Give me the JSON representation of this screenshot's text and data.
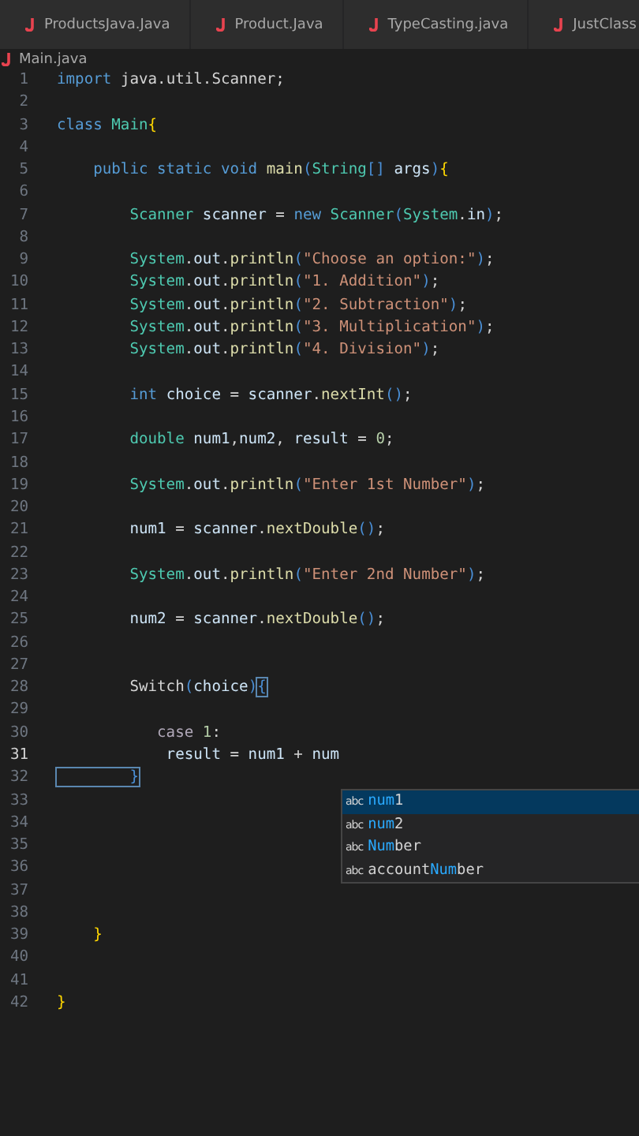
{
  "tabs": [
    {
      "label": "ProductsJava.Java",
      "selected": false
    },
    {
      "label": "Product.Java",
      "selected": false
    },
    {
      "label": "TypeCasting.java",
      "selected": false
    },
    {
      "label": "JustClass",
      "selected": false
    }
  ],
  "breadcrumb": "Main.java",
  "lines": [
    {
      "number": "1",
      "current": false,
      "tokens": [
        {
          "text": "import ",
          "kind": "kw"
        },
        {
          "text": "java.util.Scanner;",
          "kind": "plain"
        }
      ]
    },
    {
      "number": "2",
      "current": false
    },
    {
      "number": "3",
      "current": false,
      "tokens": [
        {
          "text": "class ",
          "kind": "kw"
        },
        {
          "text": "Main",
          "kind": "type"
        },
        {
          "text": "{",
          "kind": "brace"
        }
      ]
    },
    {
      "number": "4",
      "current": false
    },
    {
      "number": "5",
      "current": false,
      "tokens": [
        {
          "text": "    public static void ",
          "kind": "kw"
        },
        {
          "text": "main",
          "kind": "fn"
        },
        {
          "text": "(",
          "kind": "paren"
        },
        {
          "text": "String",
          "kind": "type"
        },
        {
          "text": "[] ",
          "kind": "paren"
        },
        {
          "text": "args",
          "kind": "var"
        },
        {
          "text": ")",
          "kind": "paren"
        },
        {
          "text": "{",
          "kind": "brace"
        }
      ]
    },
    {
      "number": "6",
      "current": false
    },
    {
      "number": "7",
      "current": false,
      "tokens": [
        {
          "text": "        Scanner ",
          "kind": "type"
        },
        {
          "text": "scanner",
          "kind": "var"
        },
        {
          "text": " = ",
          "kind": "plain"
        },
        {
          "text": "new ",
          "kind": "kw"
        },
        {
          "text": "Scanner",
          "kind": "type"
        },
        {
          "text": "(",
          "kind": "paren"
        },
        {
          "text": "System",
          "kind": "type"
        },
        {
          "text": ".",
          "kind": "plain"
        },
        {
          "text": "in",
          "kind": "var"
        },
        {
          "text": ")",
          "kind": "paren"
        },
        {
          "text": ";",
          "kind": "plain"
        }
      ]
    },
    {
      "number": "8",
      "current": false
    },
    {
      "number": "9",
      "current": false,
      "tokens": [
        {
          "text": "        System",
          "kind": "type"
        },
        {
          "text": ".",
          "kind": "plain"
        },
        {
          "text": "out",
          "kind": "var"
        },
        {
          "text": ".",
          "kind": "plain"
        },
        {
          "text": "println",
          "kind": "fn"
        },
        {
          "text": "(",
          "kind": "paren"
        },
        {
          "text": "\"Choose an option:\"",
          "kind": "str"
        },
        {
          "text": ")",
          "kind": "paren"
        },
        {
          "text": ";",
          "kind": "plain"
        }
      ]
    },
    {
      "number": "10",
      "current": false,
      "tokens": [
        {
          "text": "        System",
          "kind": "type"
        },
        {
          "text": ".",
          "kind": "plain"
        },
        {
          "text": "out",
          "kind": "var"
        },
        {
          "text": ".",
          "kind": "plain"
        },
        {
          "text": "println",
          "kind": "fn"
        },
        {
          "text": "(",
          "kind": "paren"
        },
        {
          "text": "\"1. Addition\"",
          "kind": "str"
        },
        {
          "text": ")",
          "kind": "paren"
        },
        {
          "text": ";",
          "kind": "plain"
        }
      ]
    },
    {
      "number": "11",
      "current": false,
      "tokens": [
        {
          "text": "        System",
          "kind": "type"
        },
        {
          "text": ".",
          "kind": "plain"
        },
        {
          "text": "out",
          "kind": "var"
        },
        {
          "text": ".",
          "kind": "plain"
        },
        {
          "text": "println",
          "kind": "fn"
        },
        {
          "text": "(",
          "kind": "paren"
        },
        {
          "text": "\"2. Subtraction\"",
          "kind": "str"
        },
        {
          "text": ")",
          "kind": "paren"
        },
        {
          "text": ";",
          "kind": "plain"
        }
      ]
    },
    {
      "number": "12",
      "current": false,
      "tokens": [
        {
          "text": "        System",
          "kind": "type"
        },
        {
          "text": ".",
          "kind": "plain"
        },
        {
          "text": "out",
          "kind": "var"
        },
        {
          "text": ".",
          "kind": "plain"
        },
        {
          "text": "println",
          "kind": "fn"
        },
        {
          "text": "(",
          "kind": "paren"
        },
        {
          "text": "\"3. Multiplication\"",
          "kind": "str"
        },
        {
          "text": ")",
          "kind": "paren"
        },
        {
          "text": ";",
          "kind": "plain"
        }
      ]
    },
    {
      "number": "13",
      "current": false,
      "tokens": [
        {
          "text": "        System",
          "kind": "type"
        },
        {
          "text": ".",
          "kind": "plain"
        },
        {
          "text": "out",
          "kind": "var"
        },
        {
          "text": ".",
          "kind": "plain"
        },
        {
          "text": "println",
          "kind": "fn"
        },
        {
          "text": "(",
          "kind": "paren"
        },
        {
          "text": "\"4. Division\"",
          "kind": "str"
        },
        {
          "text": ")",
          "kind": "paren"
        },
        {
          "text": ";",
          "kind": "plain"
        }
      ]
    },
    {
      "number": "14",
      "current": false
    },
    {
      "number": "15",
      "current": false,
      "tokens": [
        {
          "text": "        int ",
          "kind": "kw"
        },
        {
          "text": "choice",
          "kind": "var"
        },
        {
          "text": " = ",
          "kind": "plain"
        },
        {
          "text": "scanner",
          "kind": "var"
        },
        {
          "text": ".",
          "kind": "plain"
        },
        {
          "text": "nextInt",
          "kind": "fn"
        },
        {
          "text": "()",
          "kind": "paren"
        },
        {
          "text": ";",
          "kind": "plain"
        }
      ]
    },
    {
      "number": "16",
      "current": false
    },
    {
      "number": "17",
      "current": false,
      "tokens": [
        {
          "text": "        double ",
          "kind": "type"
        },
        {
          "text": "num1",
          "kind": "var"
        },
        {
          "text": ",",
          "kind": "plain"
        },
        {
          "text": "num2",
          "kind": "var"
        },
        {
          "text": ", ",
          "kind": "plain"
        },
        {
          "text": "result",
          "kind": "var"
        },
        {
          "text": " = ",
          "kind": "plain"
        },
        {
          "text": "0",
          "kind": "num"
        },
        {
          "text": ";",
          "kind": "plain"
        }
      ]
    },
    {
      "number": "18",
      "current": false
    },
    {
      "number": "19",
      "current": false,
      "tokens": [
        {
          "text": "        System",
          "kind": "type"
        },
        {
          "text": ".",
          "kind": "plain"
        },
        {
          "text": "out",
          "kind": "var"
        },
        {
          "text": ".",
          "kind": "plain"
        },
        {
          "text": "println",
          "kind": "fn"
        },
        {
          "text": "(",
          "kind": "paren"
        },
        {
          "text": "\"Enter 1st Number\"",
          "kind": "str"
        },
        {
          "text": ")",
          "kind": "paren"
        },
        {
          "text": ";",
          "kind": "plain"
        }
      ]
    },
    {
      "number": "20",
      "current": false
    },
    {
      "number": "21",
      "current": false,
      "tokens": [
        {
          "text": "        num1",
          "kind": "var"
        },
        {
          "text": " = ",
          "kind": "plain"
        },
        {
          "text": "scanner",
          "kind": "var"
        },
        {
          "text": ".",
          "kind": "plain"
        },
        {
          "text": "nextDouble",
          "kind": "fn"
        },
        {
          "text": "()",
          "kind": "paren"
        },
        {
          "text": ";",
          "kind": "plain"
        }
      ]
    },
    {
      "number": "22",
      "current": false
    },
    {
      "number": "23",
      "current": false,
      "tokens": [
        {
          "text": "        System",
          "kind": "type"
        },
        {
          "text": ".",
          "kind": "plain"
        },
        {
          "text": "out",
          "kind": "var"
        },
        {
          "text": ".",
          "kind": "plain"
        },
        {
          "text": "println",
          "kind": "fn"
        },
        {
          "text": "(",
          "kind": "paren"
        },
        {
          "text": "\"Enter 2nd Number\"",
          "kind": "str"
        },
        {
          "text": ")",
          "kind": "paren"
        },
        {
          "text": ";",
          "kind": "plain"
        }
      ]
    },
    {
      "number": "24",
      "current": false
    },
    {
      "number": "25",
      "current": false,
      "tokens": [
        {
          "text": "        num2",
          "kind": "var"
        },
        {
          "text": " = ",
          "kind": "plain"
        },
        {
          "text": "scanner",
          "kind": "var"
        },
        {
          "text": ".",
          "kind": "plain"
        },
        {
          "text": "nextDouble",
          "kind": "fn"
        },
        {
          "text": "()",
          "kind": "paren"
        },
        {
          "text": ";",
          "kind": "plain"
        }
      ]
    },
    {
      "number": "26",
      "current": false
    },
    {
      "number": "27",
      "current": false
    },
    {
      "number": "28",
      "current": false,
      "tokens": [
        {
          "text": "        Switch",
          "kind": "plain"
        },
        {
          "text": "(",
          "kind": "paren"
        },
        {
          "text": "choice",
          "kind": "var"
        },
        {
          "text": ")",
          "kind": "paren"
        },
        {
          "text": "{",
          "kind": "bracket-match"
        }
      ]
    },
    {
      "number": "29",
      "current": false
    },
    {
      "number": "30",
      "current": false,
      "tokens": [
        {
          "text": "           case ",
          "kind": "ctrl"
        },
        {
          "text": "1",
          "kind": "num"
        },
        {
          "text": ":",
          "kind": "plain"
        }
      ]
    },
    {
      "number": "31",
      "current": true,
      "tokens": [
        {
          "text": "            result",
          "kind": "var"
        },
        {
          "text": " = ",
          "kind": "plain"
        },
        {
          "text": "num1",
          "kind": "var"
        },
        {
          "text": " + ",
          "kind": "plain"
        },
        {
          "text": "num",
          "kind": "var"
        }
      ]
    },
    {
      "number": "32",
      "current": false,
      "tokens": [
        {
          "text": "        }",
          "kind": "bracket-match"
        }
      ]
    },
    {
      "number": "33",
      "current": false
    },
    {
      "number": "34",
      "current": false
    },
    {
      "number": "35",
      "current": false
    },
    {
      "number": "36",
      "current": false
    },
    {
      "number": "37",
      "current": false
    },
    {
      "number": "38",
      "current": false
    },
    {
      "number": "39",
      "current": false,
      "tokens": [
        {
          "text": "    }",
          "kind": "brace"
        }
      ]
    },
    {
      "number": "40",
      "current": false
    },
    {
      "number": "41",
      "current": false
    },
    {
      "number": "42",
      "current": false,
      "tokens": [
        {
          "text": "}",
          "kind": "brace"
        }
      ]
    }
  ],
  "suggestions": [
    {
      "kind_label": "abc",
      "selected": true,
      "parts": [
        {
          "text": "num",
          "match": true
        },
        {
          "text": "1",
          "match": false
        }
      ]
    },
    {
      "kind_label": "abc",
      "selected": false,
      "parts": [
        {
          "text": "num",
          "match": true
        },
        {
          "text": "2",
          "match": false
        }
      ]
    },
    {
      "kind_label": "abc",
      "selected": false,
      "parts": [
        {
          "text": "Num",
          "match": true
        },
        {
          "text": "ber",
          "match": false
        }
      ]
    },
    {
      "kind_label": "abc",
      "selected": false,
      "parts": [
        {
          "text": "account",
          "match": false
        },
        {
          "text": "Num",
          "match": true
        },
        {
          "text": "ber",
          "match": false
        }
      ]
    }
  ]
}
